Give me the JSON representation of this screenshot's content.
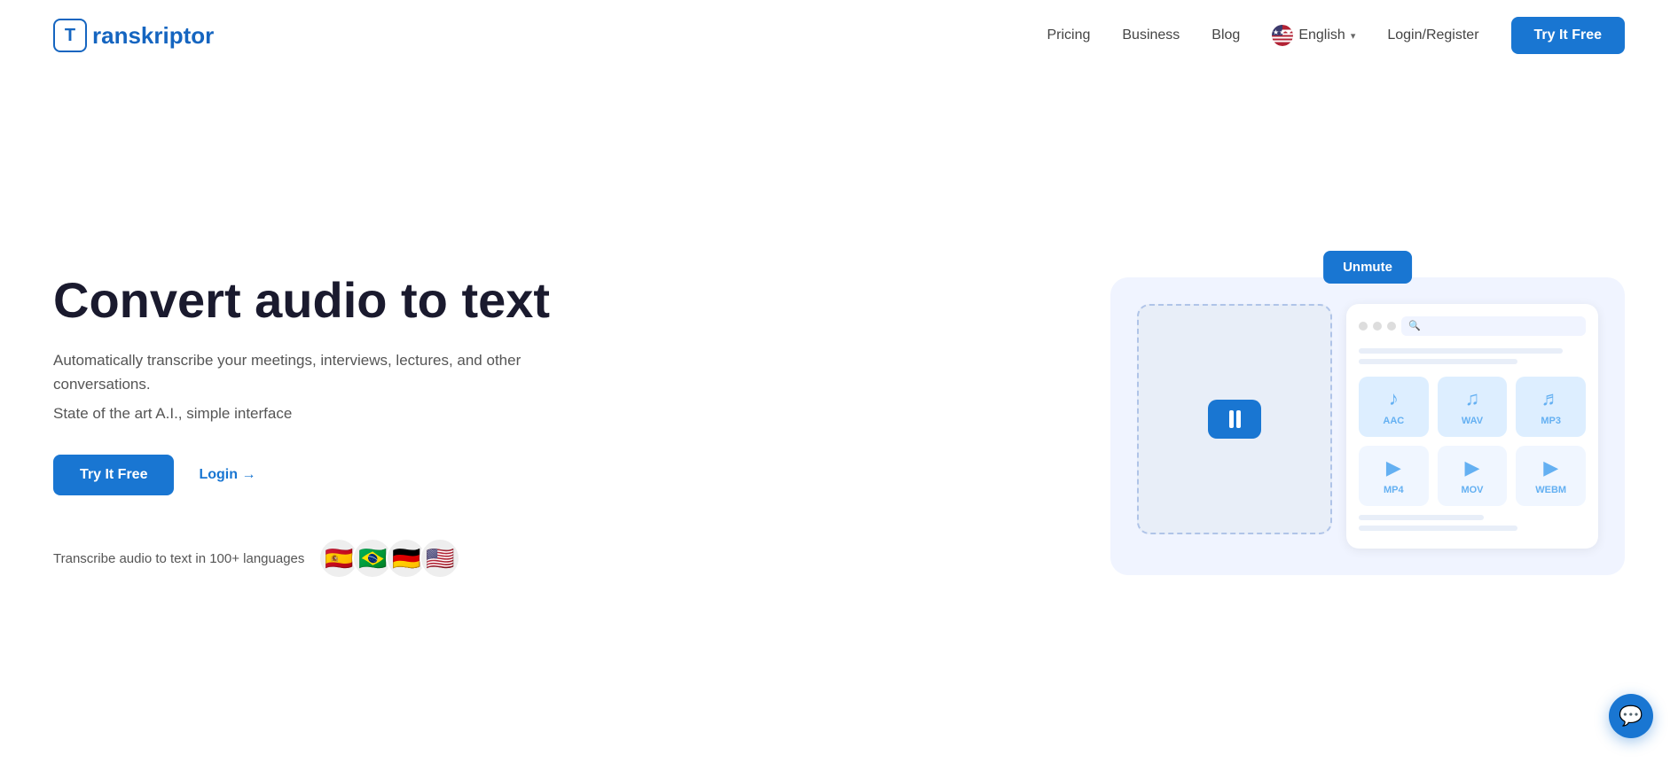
{
  "nav": {
    "logo_letter": "T",
    "logo_name": "ranskriptor",
    "links": [
      {
        "label": "Pricing",
        "href": "#"
      },
      {
        "label": "Business",
        "href": "#"
      },
      {
        "label": "Blog",
        "href": "#"
      }
    ],
    "language": "English",
    "login_label": "Login/Register",
    "cta_label": "Try It Free"
  },
  "hero": {
    "title": "Convert audio to text",
    "desc1": "Automatically transcribe your meetings, interviews, lectures, and other conversations.",
    "desc2": "State of the art A.I., simple interface",
    "try_btn": "Try It Free",
    "login_btn": "Login →",
    "languages_text": "Transcribe audio to text in 100+ languages",
    "flags": [
      "🇪🇸",
      "🇧🇷",
      "🇩🇪",
      "🇺🇸"
    ]
  },
  "illustration": {
    "unmute_btn": "Unmute",
    "file_types": [
      {
        "label": "AAC",
        "type": "audio"
      },
      {
        "label": "WAV",
        "type": "audio"
      },
      {
        "label": "MP3",
        "type": "audio"
      },
      {
        "label": "MP4",
        "type": "video"
      },
      {
        "label": "MOV",
        "type": "video"
      },
      {
        "label": "WEBM",
        "type": "video"
      }
    ]
  },
  "chat": {
    "icon": "💬"
  }
}
